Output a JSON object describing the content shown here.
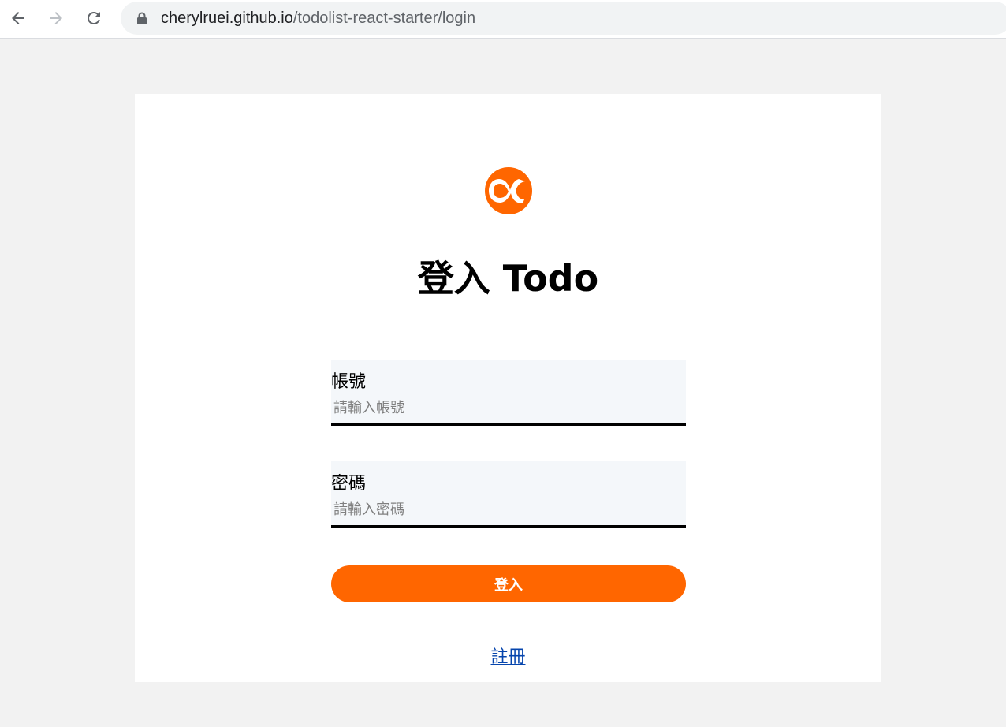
{
  "browser": {
    "url_host": "cherylruei.github.io",
    "url_path": "/todolist-react-starter/login",
    "icons": [
      "back-arrow-icon",
      "forward-arrow-icon",
      "reload-icon",
      "lock-icon"
    ]
  },
  "login": {
    "logo_icon": "alpha-logo-icon",
    "title": "登入 Todo",
    "account": {
      "label": "帳號",
      "placeholder": "請輸入帳號",
      "value": ""
    },
    "password": {
      "label": "密碼",
      "placeholder": "請輸入密碼",
      "value": ""
    },
    "submit_label": "登入",
    "register_link": "註冊"
  },
  "colors": {
    "accent": "#ff6600",
    "page_bg": "#f2f2f2",
    "field_bg": "#f4f7fa",
    "link": "#0645ad"
  }
}
